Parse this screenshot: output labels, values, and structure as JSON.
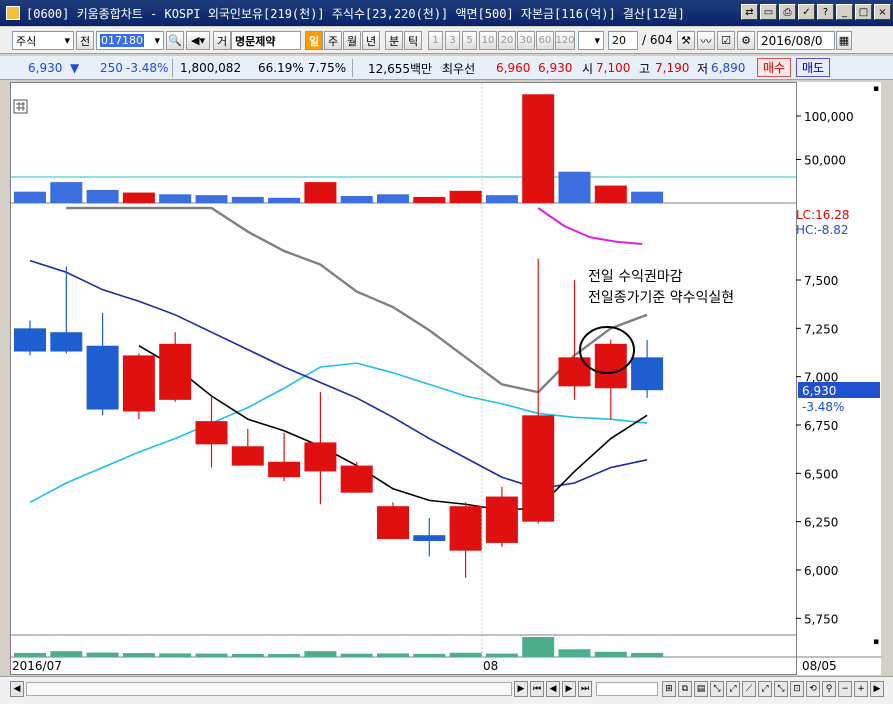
{
  "window": {
    "title": "[0600] 키움종합차트 - KOSPI 외국인보유[219(천)] 주식수[23,220(천)] 액면[500] 자본금[116(억)] 결산[12월]"
  },
  "toolbar": {
    "market_type": "주식",
    "code_label": "전",
    "stock_code": "017180",
    "stock_name_prefix": "거",
    "stock_name": "명문제약",
    "period_buttons": [
      "일",
      "주",
      "월",
      "년",
      "분",
      "틱"
    ],
    "minute_buttons": [
      "1",
      "3",
      "5",
      "10",
      "20",
      "30",
      "60",
      "120"
    ],
    "count_value": "20",
    "total_count": "/ 604",
    "date": "2016/08/0"
  },
  "quote": {
    "price": "6,930",
    "change_arrow": "▼",
    "change": "250",
    "change_pct": "-3.48%",
    "volume": "1,800,082",
    "volume_ratio": "66.19%",
    "turnover": "7.75%",
    "trade_value": "12,655백만",
    "best_label": "최우선",
    "best_ask": "6,960",
    "best_bid": "6,930",
    "open_label": "시",
    "open": "7,100",
    "high_label": "고",
    "high": "7,190",
    "low_label": "저",
    "low": "6,890",
    "buy_label": "매수",
    "sell_label": "매도"
  },
  "chart": {
    "volume_axis_labels": [
      "100,000",
      "50,000"
    ],
    "lc_label": "LC:16.28",
    "hc_label": "HC:-8.82",
    "price_axis_labels": [
      "7,500",
      "7,250",
      "7,000",
      "6,750",
      "6,500",
      "6,250",
      "6,000",
      "5,750"
    ],
    "current_price_tag": "6,930",
    "current_change_tag": "-3.48%",
    "annotation_line1": "전일 수익권마감",
    "annotation_line2": "전일종가기준 약수익실현",
    "x_label_start": "2016/07",
    "x_label_mid": "08",
    "x_label_right": "08/05"
  },
  "chart_data": {
    "type": "candlestick",
    "ylim": [
      5700,
      7800
    ],
    "candles": [
      {
        "o": 7250,
        "c": 7130,
        "h": 7290,
        "l": 7110
      },
      {
        "o": 7230,
        "c": 7130,
        "h": 7570,
        "l": 7120
      },
      {
        "o": 7160,
        "c": 6830,
        "h": 7330,
        "l": 6800
      },
      {
        "o": 6820,
        "c": 7110,
        "h": 7120,
        "l": 6780
      },
      {
        "o": 6880,
        "c": 7170,
        "h": 7230,
        "l": 6870
      },
      {
        "o": 6650,
        "c": 6770,
        "h": 6900,
        "l": 6530
      },
      {
        "o": 6540,
        "c": 6640,
        "h": 6730,
        "l": 6540
      },
      {
        "o": 6480,
        "c": 6560,
        "h": 6710,
        "l": 6460
      },
      {
        "o": 6510,
        "c": 6660,
        "h": 6920,
        "l": 6340
      },
      {
        "o": 6400,
        "c": 6540,
        "h": 6560,
        "l": 6400
      },
      {
        "o": 6160,
        "c": 6330,
        "h": 6350,
        "l": 6160
      },
      {
        "o": 6180,
        "c": 6150,
        "h": 6270,
        "l": 6070
      },
      {
        "o": 6100,
        "c": 6330,
        "h": 6350,
        "l": 5960
      },
      {
        "o": 6140,
        "c": 6380,
        "h": 6430,
        "l": 6120
      },
      {
        "o": 6250,
        "c": 6800,
        "h": 7610,
        "l": 6240
      },
      {
        "o": 6950,
        "c": 7100,
        "h": 7500,
        "l": 6880
      },
      {
        "o": 6940,
        "c": 7170,
        "h": 7190,
        "l": 6780
      },
      {
        "o": 7100,
        "c": 6930,
        "h": 7190,
        "l": 6890
      }
    ],
    "volume": [
      13000,
      24000,
      15000,
      12000,
      10000,
      9000,
      7000,
      6000,
      24000,
      8000,
      10000,
      7000,
      14000,
      9000,
      125000,
      36000,
      20000,
      13000
    ],
    "volume_up": [
      false,
      false,
      false,
      true,
      false,
      false,
      false,
      false,
      true,
      false,
      false,
      true,
      true,
      false,
      true,
      false,
      true,
      false
    ],
    "ma_black": [
      null,
      null,
      null,
      7160,
      7050,
      6900,
      6780,
      6720,
      6640,
      6540,
      6420,
      6360,
      6340,
      6310,
      6320,
      6510,
      6680,
      6800
    ],
    "ma_navy": [
      7600,
      7540,
      7450,
      7390,
      7320,
      7230,
      7140,
      7050,
      6970,
      6890,
      6790,
      6680,
      6580,
      6480,
      6420,
      6450,
      6530,
      6570
    ],
    "ma_cyan": [
      6350,
      6450,
      6530,
      6610,
      6680,
      6760,
      6840,
      6940,
      7050,
      7070,
      7020,
      6960,
      6900,
      6860,
      6810,
      6790,
      6780,
      6760
    ],
    "ma_gray": [
      8200,
      8050,
      7920,
      7900,
      7920,
      7750,
      7650,
      7580,
      7440,
      7360,
      7240,
      7100,
      6960,
      6920,
      7110,
      7250,
      7320
    ],
    "osc_magenta": [
      100,
      60,
      35,
      25,
      20
    ]
  }
}
